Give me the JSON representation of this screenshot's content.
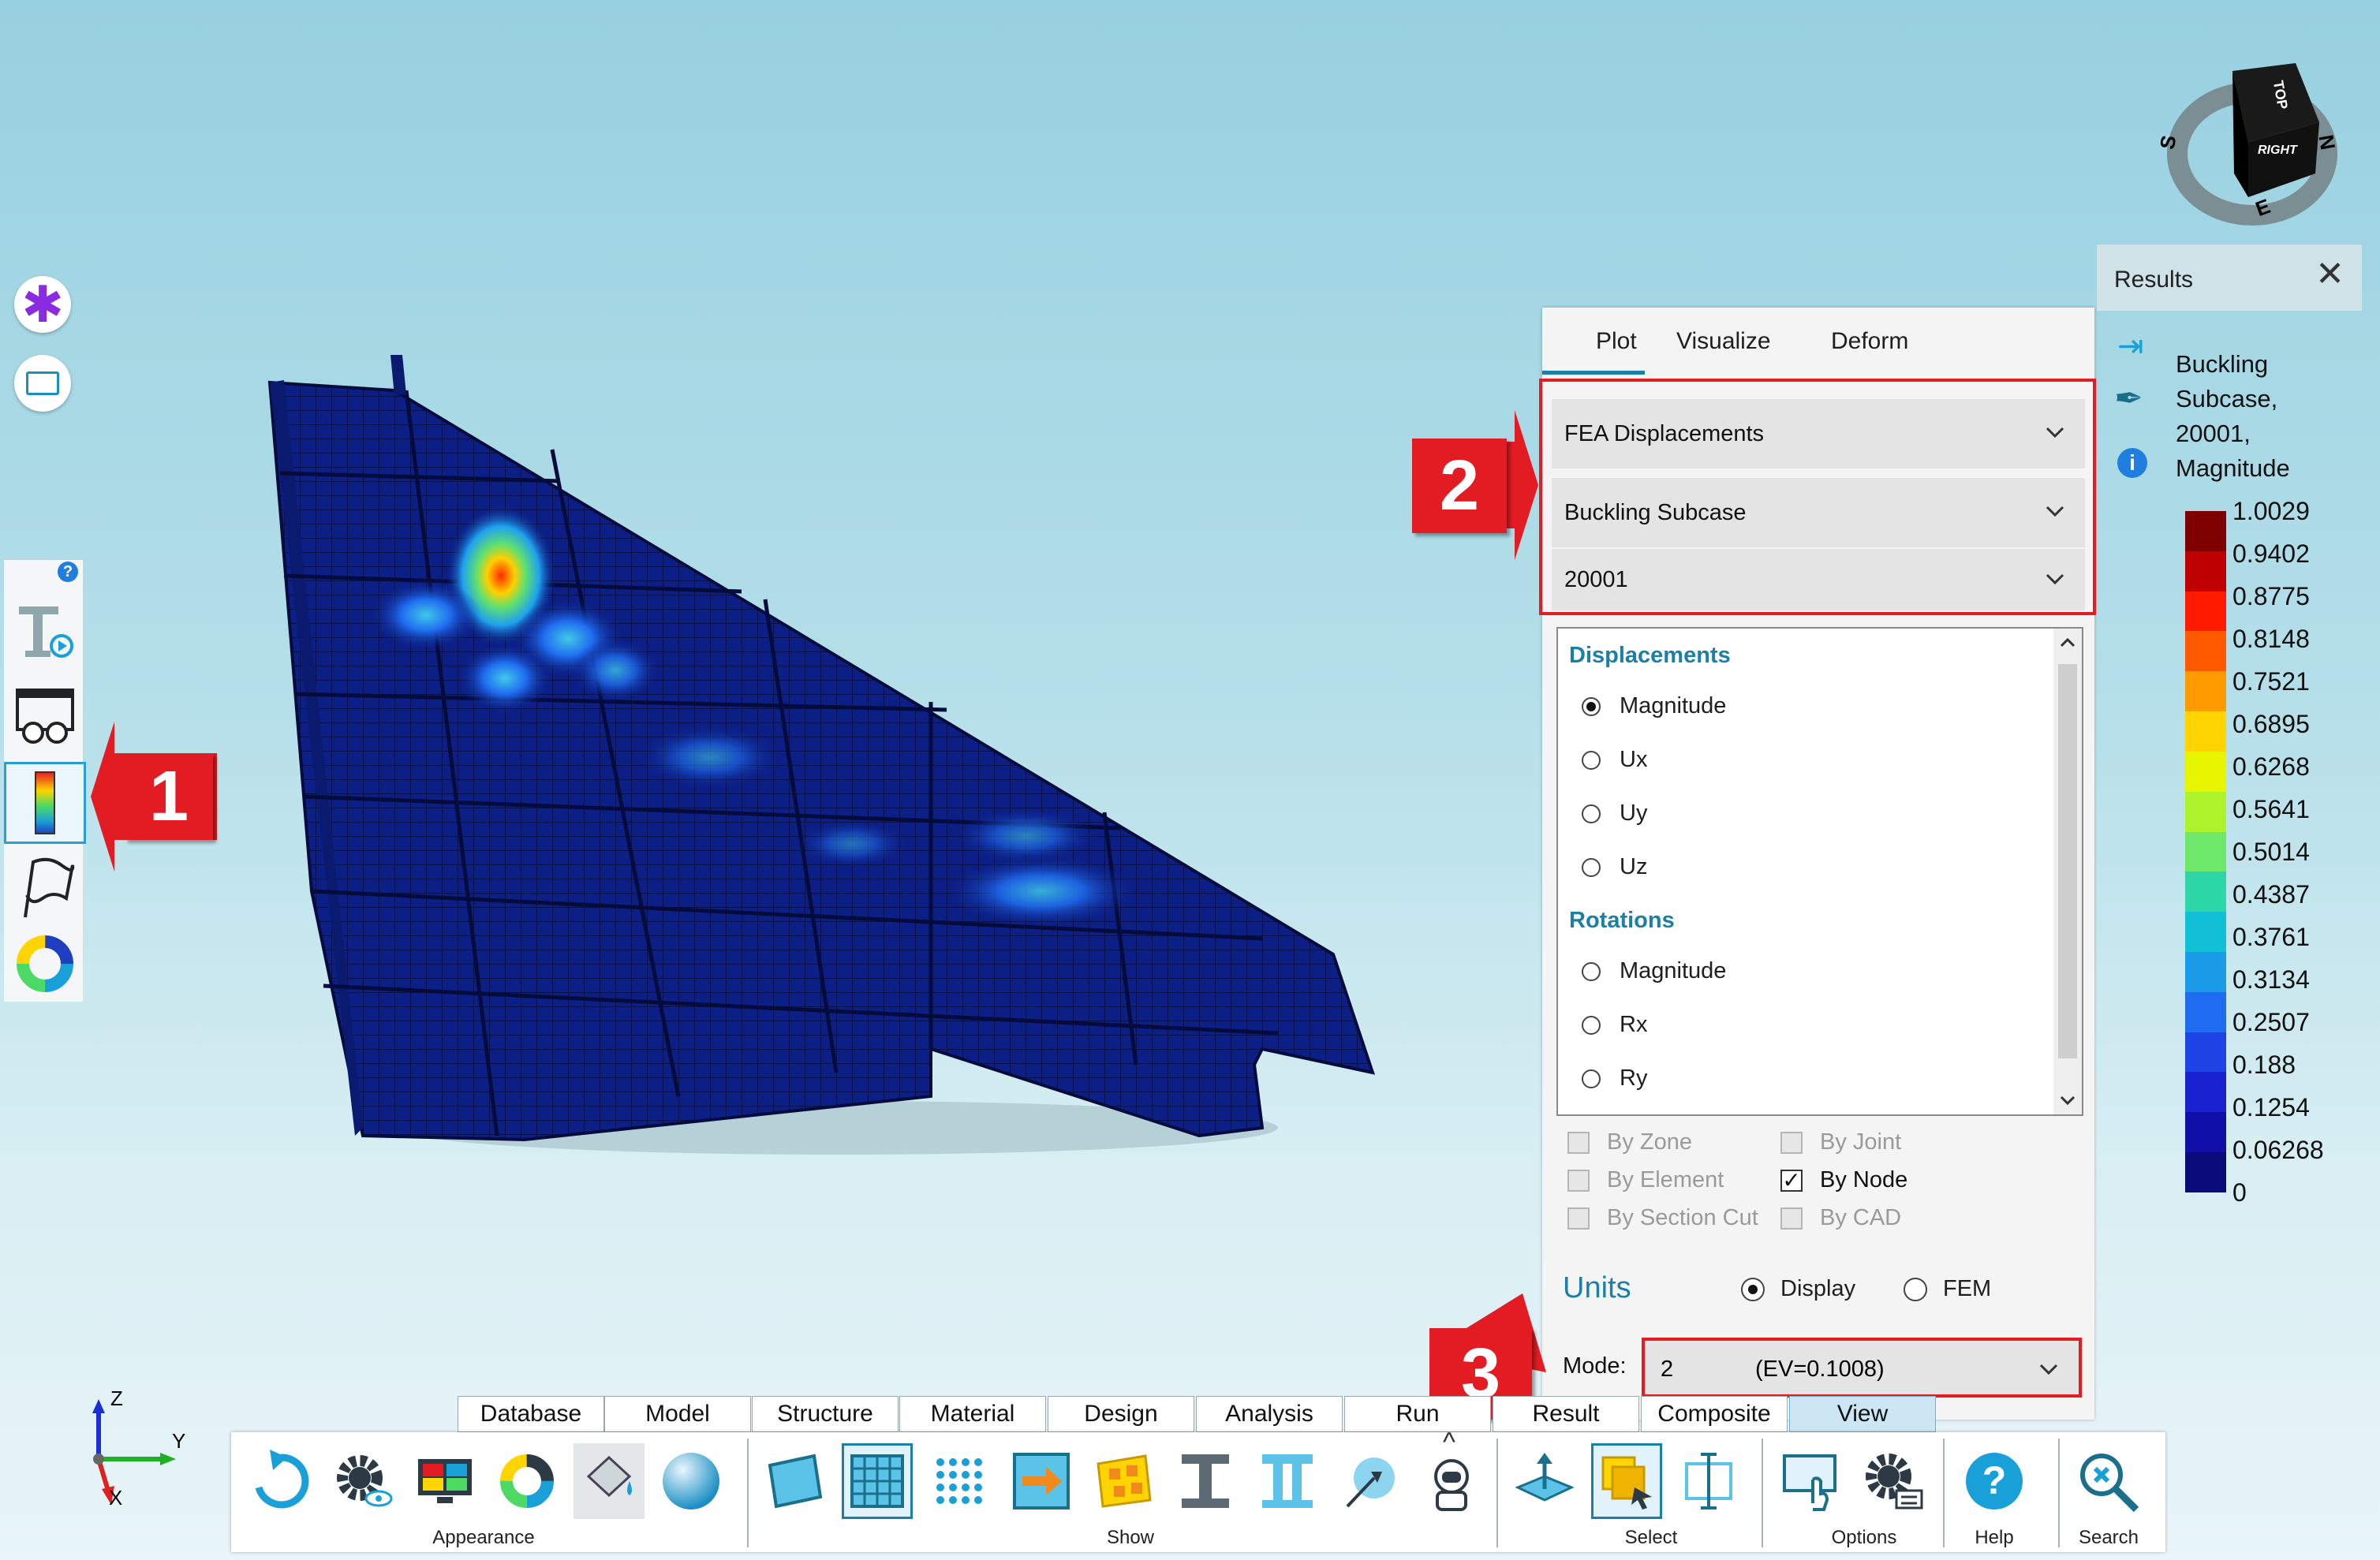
{
  "viewcube": {
    "top": "TOP",
    "right": "RIGHT",
    "compass_s": "S",
    "compass_n": "N",
    "compass_e": "E"
  },
  "triad": {
    "z": "Z",
    "y": "Y",
    "x": "X"
  },
  "callouts": [
    "1",
    "2",
    "3"
  ],
  "plot_panel": {
    "tabs": [
      "Plot",
      "Visualize",
      "Deform"
    ],
    "active_tab": "Plot",
    "result_type": "FEA Displacements",
    "subcase_type": "Buckling Subcase",
    "subcase_id": "20001",
    "displacements": {
      "heading": "Displacements",
      "options": [
        "Magnitude",
        "Ux",
        "Uy",
        "Uz"
      ],
      "selected": "Magnitude"
    },
    "rotations": {
      "heading": "Rotations",
      "options": [
        "Magnitude",
        "Rx",
        "Ry"
      ]
    },
    "by_options": {
      "left": [
        "By Zone",
        "By Element",
        "By Section Cut"
      ],
      "right": [
        "By Joint",
        "By Node",
        "By CAD"
      ],
      "checked": "By Node"
    },
    "units": {
      "label": "Units",
      "display": "Display",
      "fem": "FEM",
      "selected": "Display"
    },
    "mode": {
      "label": "Mode:",
      "number": "2",
      "ev": "(EV=0.1008)"
    }
  },
  "results": {
    "header": "Results",
    "title_lines": [
      "Buckling",
      "Subcase,",
      "20001,",
      "Magnitude"
    ],
    "legend_values": [
      "1.0029",
      "0.9402",
      "0.8775",
      "0.8148",
      "0.7521",
      "0.6895",
      "0.6268",
      "0.5641",
      "0.5014",
      "0.4387",
      "0.3761",
      "0.3134",
      "0.2507",
      "0.188",
      "0.1254",
      "0.06268",
      "0"
    ],
    "legend_colors": [
      "#7f0000",
      "#bf0000",
      "#ff1a00",
      "#ff5a00",
      "#ff9a00",
      "#ffd400",
      "#e8f500",
      "#aef22c",
      "#6ee86a",
      "#2dd6a6",
      "#11c0d6",
      "#1a9be8",
      "#1f6cf0",
      "#1f44e6",
      "#1a22d0",
      "#1010a8",
      "#0a0a78"
    ]
  },
  "ribbon": {
    "tabs": [
      "Database",
      "Model",
      "Structure",
      "Material",
      "Design",
      "Analysis",
      "Run",
      "Result",
      "Composite",
      "View"
    ],
    "active_tab": "View",
    "groups": [
      "Appearance",
      "Show",
      "Select",
      "Options",
      "Help",
      "Search"
    ]
  },
  "colors": {
    "accent": "#1b7fa8",
    "callout_red": "#e31b23",
    "mesh_dark": "#0a1a6e"
  }
}
